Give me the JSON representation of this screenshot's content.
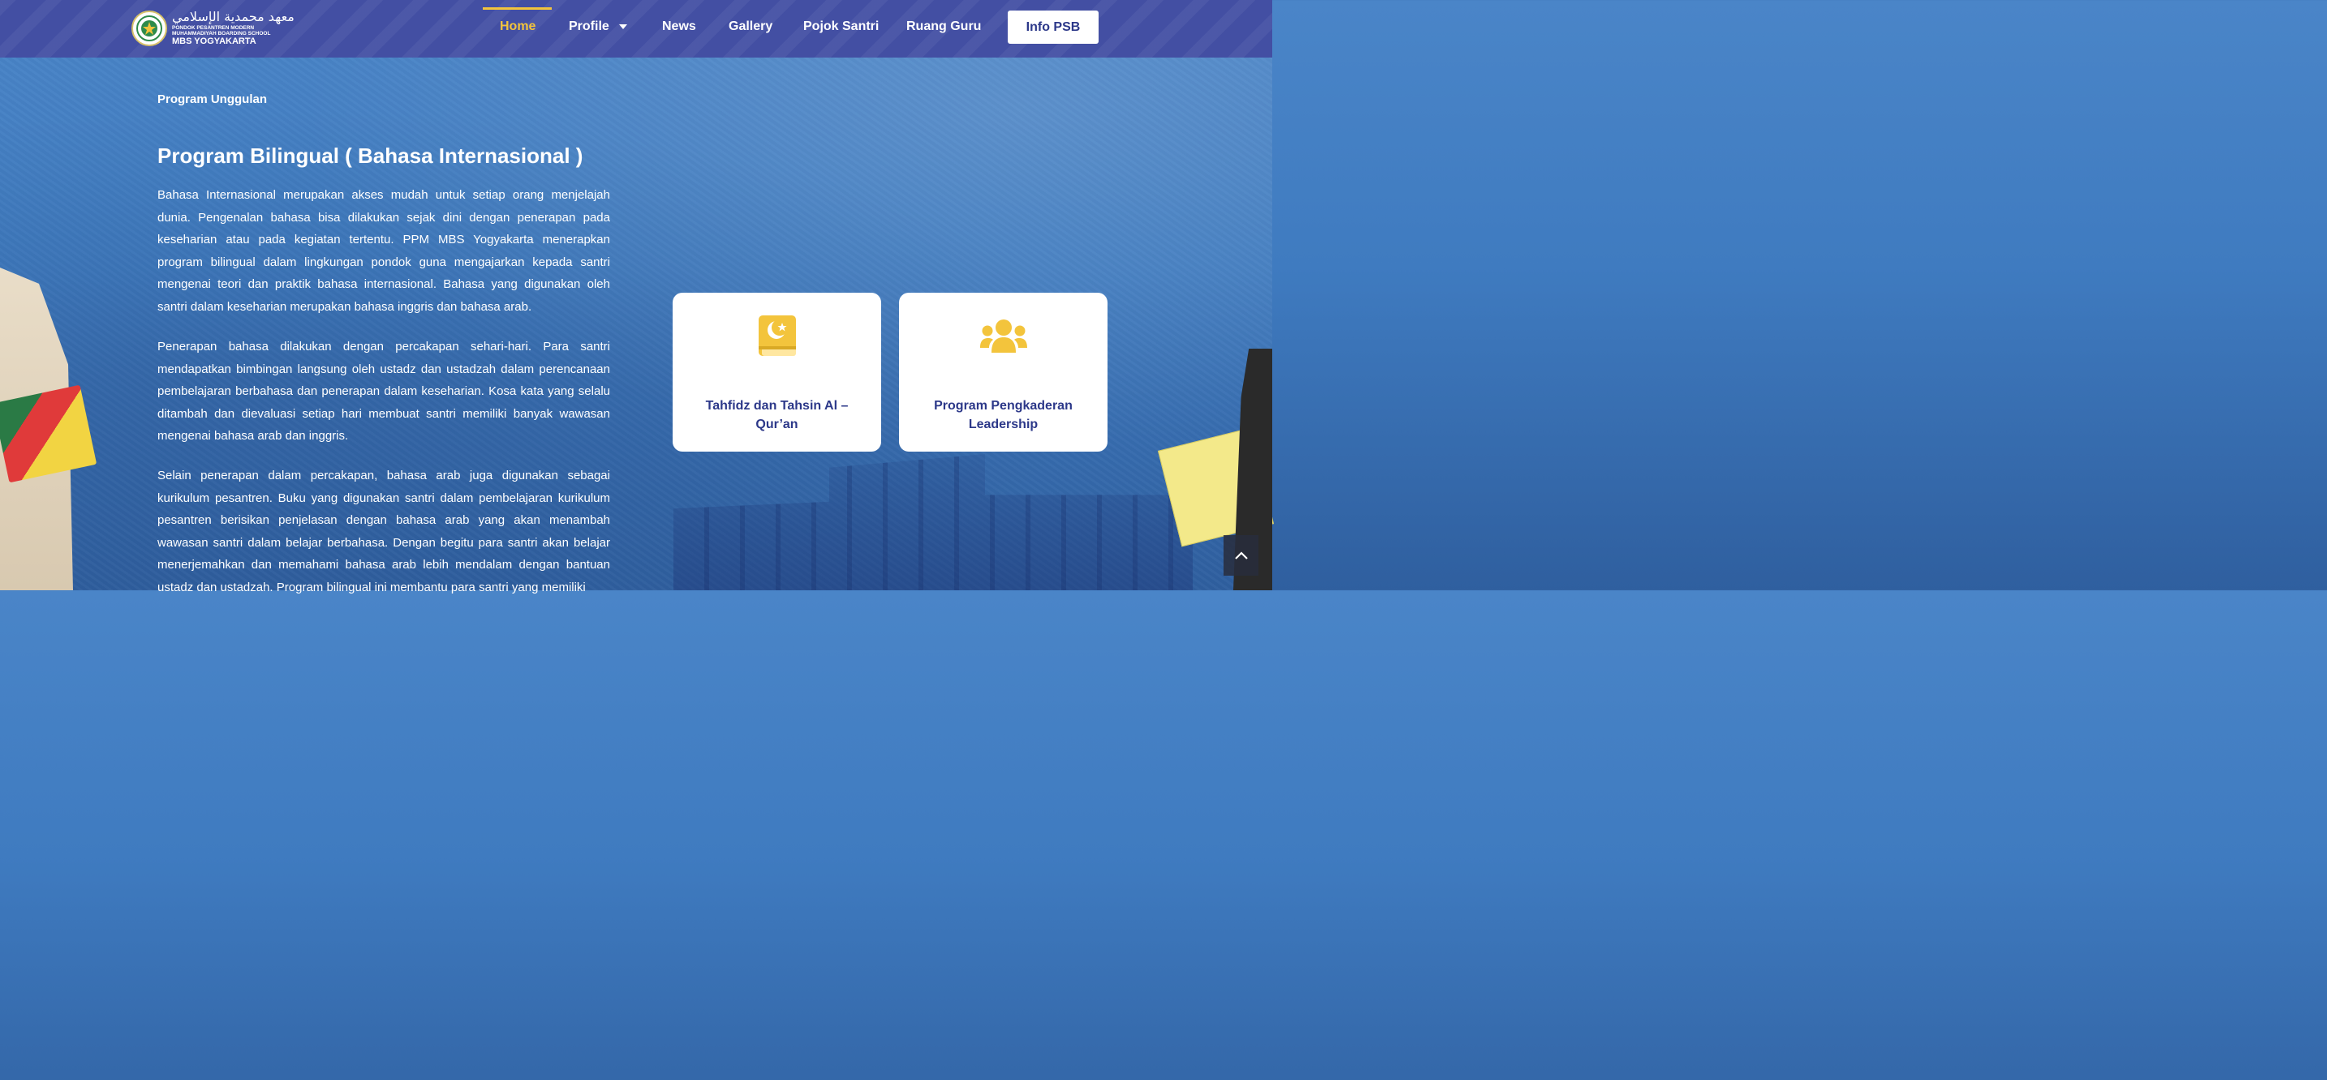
{
  "nav": {
    "logo": {
      "arabic": "معهد محمدية الإسلامي",
      "subtitle_line1": "PONDOK PESANTREN MODERN",
      "subtitle_line2": "MUHAMMADIYAH BOARDING SCHOOL",
      "main": "MBS YOGYAKARTA"
    },
    "items": [
      {
        "label": "Home",
        "active": true
      },
      {
        "label": "Profile",
        "has_dropdown": true
      },
      {
        "label": "News"
      },
      {
        "label": "Gallery"
      },
      {
        "label": "Pojok Santri"
      },
      {
        "label": "Ruang Guru"
      }
    ],
    "cta": "Info PSB",
    "active_color": "#f3c43c",
    "bg_color": "#434fa3"
  },
  "content": {
    "eyebrow": "Program Unggulan",
    "title": "Program Bilingual ( Bahasa Internasional )",
    "paragraphs": [
      "Bahasa Internasional merupakan akses mudah untuk setiap orang menjelajah dunia. Pengenalan bahasa bisa dilakukan sejak dini dengan penerapan pada keseharian atau pada kegiatan tertentu. PPM MBS Yogyakarta menerapkan program bilingual dalam lingkungan pondok guna mengajarkan kepada santri mengenai teori dan praktik bahasa internasional. Bahasa yang digunakan oleh santri dalam keseharian merupakan bahasa inggris dan bahasa arab.",
      "Penerapan bahasa dilakukan dengan percakapan sehari-hari. Para santri mendapatkan bimbingan langsung oleh ustadz dan ustadzah dalam perencanaan pembelajaran berbahasa dan penerapan dalam keseharian. Kosa kata yang selalu ditambah dan dievaluasi setiap hari membuat santri memiliki banyak wawasan mengenai bahasa arab dan inggris.",
      "Selain penerapan dalam percakapan, bahasa arab juga digunakan sebagai kurikulum pesantren. Buku yang digunakan santri dalam pembelajaran kurikulum pesantren berisikan penjelasan dengan bahasa arab yang akan menambah wawasan santri dalam belajar berbahasa. Dengan begitu para santri akan belajar menerjemahkan dan memahami bahasa arab lebih mendalam dengan bantuan ustadz dan ustadzah. Program bilingual ini membantu para santri yang memiliki"
    ]
  },
  "cards": [
    {
      "label": "Tahfidz dan Tahsin Al – Qur’an",
      "icon": "quran-book-icon"
    },
    {
      "label": "Program Pengkaderan Leadership",
      "icon": "users-group-icon"
    }
  ],
  "colors": {
    "accent_yellow": "#f3c43c",
    "brand_navy": "#2c3889"
  },
  "scroll_top_icon": "chevron-up-icon"
}
